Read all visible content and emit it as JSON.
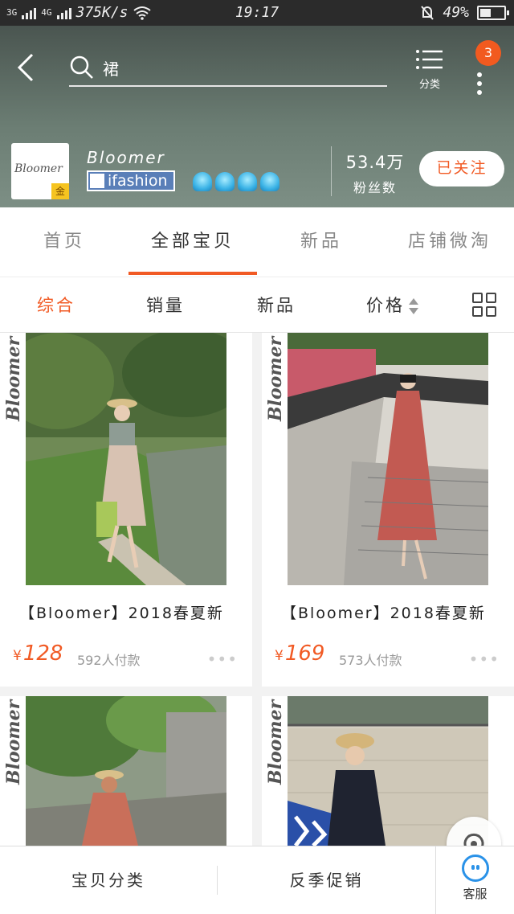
{
  "status_bar": {
    "network_left": "3G",
    "network_right": "4G",
    "speed": "375K/s",
    "time": "19:17",
    "battery": "49%"
  },
  "search": {
    "value": "裙"
  },
  "header": {
    "menu_label": "分类",
    "notification_count": "3"
  },
  "shop": {
    "logo_text": "Bloomer",
    "logo_badge": "金",
    "name": "Bloomer",
    "tag": "ifashion",
    "fans_count": "53.4万",
    "fans_label": "粉丝数",
    "follow_label": "已关注"
  },
  "tabs": [
    {
      "label": "首页"
    },
    {
      "label": "全部宝贝"
    },
    {
      "label": "新品"
    },
    {
      "label": "店铺微淘"
    }
  ],
  "sort": {
    "comprehensive": "综合",
    "sales": "销量",
    "new": "新品",
    "price": "价格"
  },
  "products": [
    {
      "brand": "Bloomer",
      "title": "【Bloomer】2018春夏新",
      "currency": "¥",
      "price": "128",
      "sold": "592人付款",
      "more": "•••"
    },
    {
      "brand": "Bloomer",
      "title": "【Bloomer】2018春夏新",
      "currency": "¥",
      "price": "169",
      "sold": "573人付款",
      "more": "•••"
    },
    {
      "brand": "Bloomer"
    },
    {
      "brand": "Bloomer"
    }
  ],
  "bottom_bar": {
    "category": "宝贝分类",
    "promo": "反季促销",
    "service": "客服"
  },
  "colors": {
    "accent": "#f15a24",
    "header_bg": "#6b7d73",
    "service_blue": "#2a92e8"
  }
}
